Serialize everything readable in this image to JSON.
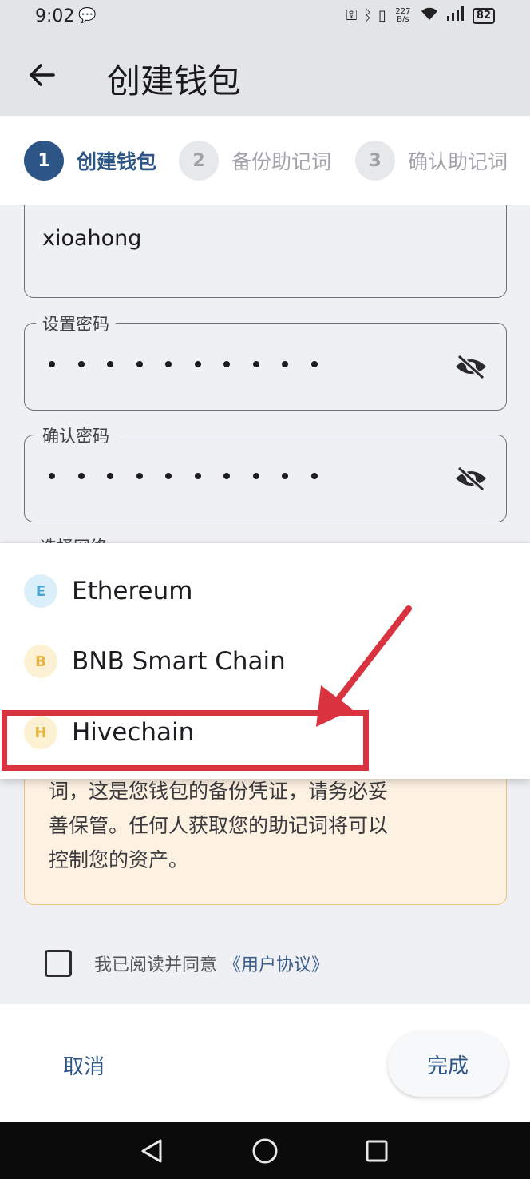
{
  "status_bar": {
    "time": "9:02",
    "net_speed_value": "227",
    "net_speed_unit": "B/s",
    "network": "4G",
    "battery": "82"
  },
  "app_bar": {
    "title": "创建钱包"
  },
  "stepper": {
    "steps": [
      {
        "num": "1",
        "label": "创建钱包",
        "active": true
      },
      {
        "num": "2",
        "label": "备份助记词",
        "active": false
      },
      {
        "num": "3",
        "label": "确认助记词",
        "active": false
      }
    ]
  },
  "form": {
    "wallet_name_value": "xioahong",
    "password": {
      "label": "设置密码",
      "masked_length": 10
    },
    "confirm_password": {
      "label": "确认密码",
      "masked_length": 10
    },
    "network_label_partial": "选择网络"
  },
  "network_menu": {
    "options": [
      {
        "initial": "E",
        "name": "Ethereum",
        "color": "#dbeffa",
        "text_color": "#4ba6cf"
      },
      {
        "initial": "B",
        "name": "BNB Smart Chain",
        "color": "#fcf1d2",
        "text_color": "#e5b23b"
      },
      {
        "initial": "H",
        "name": "Hivechain",
        "color": "#fcf1d2",
        "text_color": "#e5b23b"
      }
    ]
  },
  "warning": {
    "lines": [
      "词，这是您钱包的备份凭证，请务必妥",
      "善保管。任何人获取您的助记词将可以",
      "控制您的资产。"
    ]
  },
  "agreement": {
    "text": "我已阅读并同意",
    "link": "《用户协议》",
    "checked": false
  },
  "actions": {
    "cancel": "取消",
    "done": "完成"
  },
  "colors": {
    "primary": "#2d5686",
    "annotation": "#d8333e",
    "warning_bg": "#fdf1e2",
    "warning_border": "#ecc27c"
  }
}
